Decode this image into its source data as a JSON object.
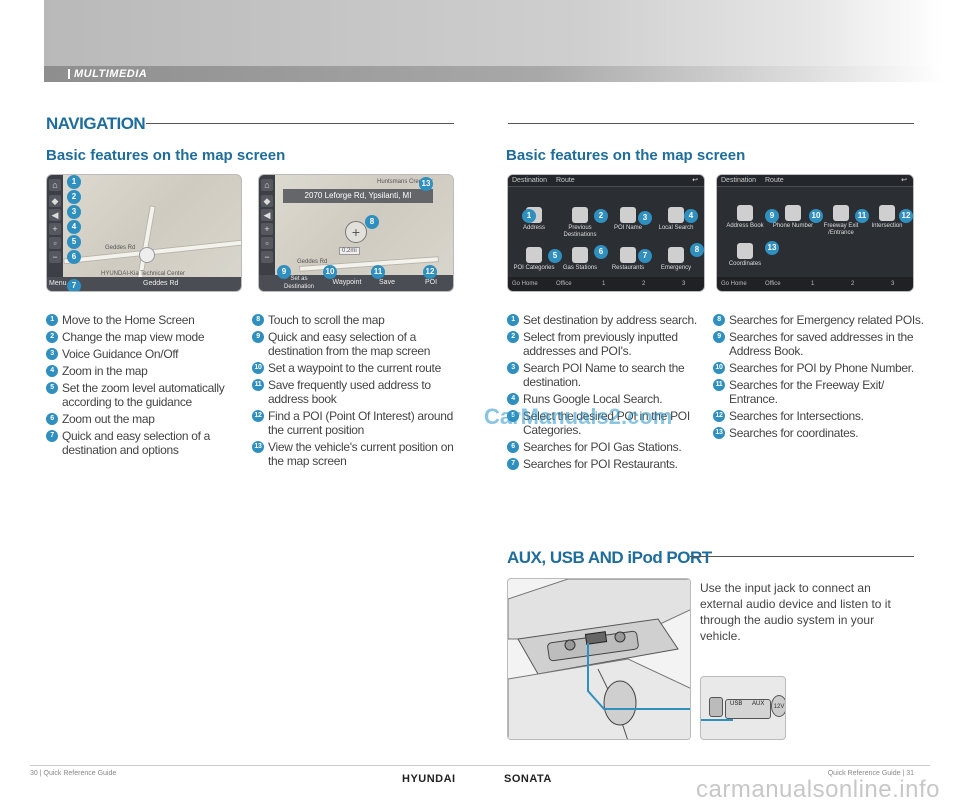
{
  "header": {
    "section": "MULTIMEDIA"
  },
  "navigation": {
    "title": "NAVIGATION",
    "left_subtitle": "Basic features on the map screen",
    "right_subtitle": "Basic features on the map screen",
    "map1": {
      "road1": "Geddes Rd",
      "center": "HYUNDAI-Kia Technical Center",
      "menu": "Menu",
      "bottom_road": "Geddes Rd"
    },
    "map2": {
      "address": "2070 Leforge Rd, Ypsilanti, MI",
      "road_top": "Huntsmans Creek Dr",
      "road": "Geddes Rd",
      "distance": "0.2mi",
      "buttons": [
        "Set as Destination",
        "Waypoint",
        "Save",
        "POI"
      ]
    },
    "dest1": {
      "tabs": [
        "Destination",
        "Route"
      ],
      "tiles": [
        "Address",
        "Previous Destinations",
        "POI Name",
        "Local Search",
        "POI Categories",
        "Gas Stations",
        "Restaurants",
        "Emergency"
      ],
      "bottom": [
        "Go Home",
        "Office",
        "1",
        "2",
        "3"
      ]
    },
    "dest2": {
      "tabs": [
        "Destination",
        "Route"
      ],
      "tiles": [
        "Address Book",
        "Phone Number",
        "Freeway Exit /Entrance",
        "Intersection",
        "Coordinates"
      ],
      "bottom": [
        "Go Home",
        "Office",
        "1",
        "2",
        "3"
      ]
    },
    "list_left": [
      "Move to the Home Screen",
      "Change the map view mode",
      "Voice Guidance On/Off",
      "Zoom in the map",
      "Set the zoom level automatically according to the guidance",
      "Zoom out the map",
      "Quick and easy selection of a destination and options"
    ],
    "list_mid": [
      "Touch to scroll the map",
      "Quick and easy selection of a destination from the map screen",
      "Set a waypoint to the current route",
      "Save frequently used address to address book",
      "Find a POI (Point Of Interest) around the current position",
      "View the vehicle's current position on the map screen"
    ],
    "list_right_a": [
      "Set destination by address search.",
      "Select from previously inputted addresses and POI's.",
      "Search POI Name to search the destination.",
      "Runs Google Local Search.",
      "Select the desired POI in the POI Categories.",
      "Searches for POI Gas Stations.",
      "Searches for POI Restaurants."
    ],
    "list_right_b": [
      "Searches for Emergency related POIs.",
      "Searches for saved addresses in the Address Book.",
      "Searches for POI by Phone Number.",
      "Searches for the Freeway Exit/ Entrance.",
      "Searches for Intersections.",
      "Searches for coordinates."
    ]
  },
  "aux": {
    "title": "AUX, USB AND iPod PORT",
    "text": "Use the input jack to connect an external audio device and listen to it through the audio system in your vehicle.",
    "ports": [
      "USB",
      "AUX",
      "12V"
    ]
  },
  "footer": {
    "left": "30 | Quick Reference Guide",
    "right": "Quick Reference Guide | 31",
    "brand1": "HYUNDAI",
    "brand2": "SONATA",
    "watermark": "carmanualsonline.info",
    "overlay": "CarManuals2.com"
  }
}
